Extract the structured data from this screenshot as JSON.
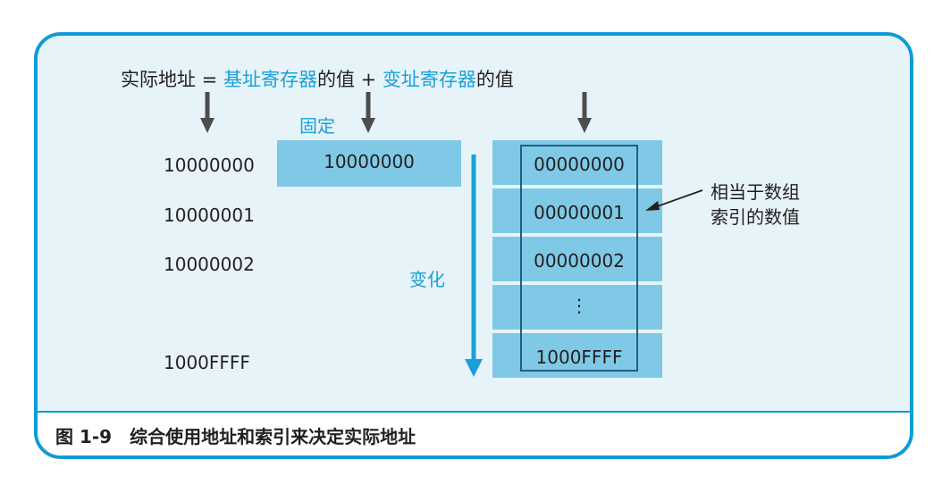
{
  "formula": {
    "prefix": "实际地址 = ",
    "base_register": "基址寄存器",
    "value_of_1": "的值",
    "plus": " + ",
    "index_register": "变址寄存器",
    "value_of_2": "的值"
  },
  "fixed_label": "固定",
  "changing_label": "变化",
  "addresses": [
    "10000000",
    "10000001",
    "10000002",
    "1000FFFF"
  ],
  "base_value": "10000000",
  "index_values": [
    "00000000",
    "00000001",
    "00000002",
    "⋮",
    "1000FFFF"
  ],
  "annotation": {
    "line1": "相当于数组",
    "line2": "索引的数值"
  },
  "caption": "图 1-9　综合使用地址和索引来决定实际地址",
  "colors": {
    "accent_blue": "#0f9bd7",
    "text_blue": "#1aa0d8",
    "cell_fill": "#7fc9e6",
    "panel_bg": "#e6f4f9",
    "frame_dark": "#1d5f86",
    "arrow_gray": "#4d4d4d"
  }
}
